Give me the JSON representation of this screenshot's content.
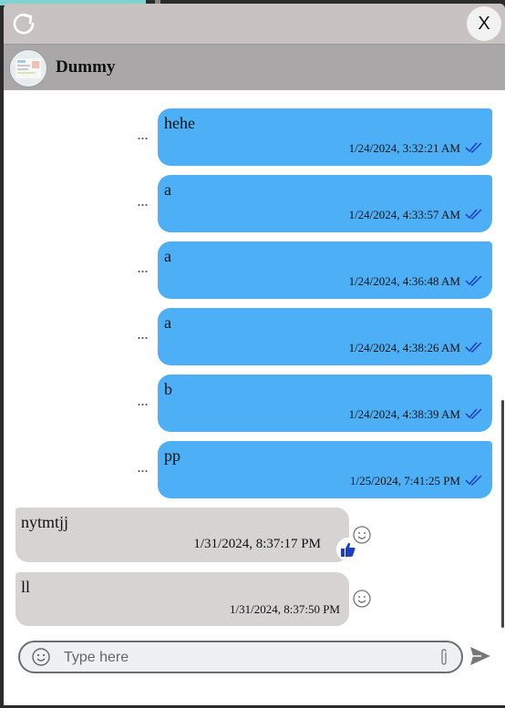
{
  "window": {
    "close_label": "X"
  },
  "contact": {
    "name": "Dummy"
  },
  "sent_messages": [
    {
      "text": "hehe",
      "time": "1/24/2024, 3:32:21 AM"
    },
    {
      "text": "a",
      "time": "1/24/2024, 4:33:57 AM"
    },
    {
      "text": "a",
      "time": "1/24/2024, 4:36:48 AM"
    },
    {
      "text": "a",
      "time": "1/24/2024, 4:38:26 AM"
    },
    {
      "text": "b",
      "time": "1/24/2024, 4:38:39 AM"
    },
    {
      "text": "pp",
      "time": "1/25/2024, 7:41:25 PM"
    }
  ],
  "received_messages": [
    {
      "text": "nytmtjj",
      "time": "1/31/2024, 8:37:17 PM",
      "reaction": "thumbs-up-icon"
    },
    {
      "text": "ll",
      "time": "1/31/2024, 8:37:50 PM"
    }
  ],
  "more_label": "...",
  "composer": {
    "placeholder": "Type here",
    "value": ""
  },
  "colors": {
    "sent_bubble": "#4db0f7",
    "received_bubble": "#d6d3d3",
    "read_check": "#1f3fbf",
    "like": "#1b3fc2"
  }
}
